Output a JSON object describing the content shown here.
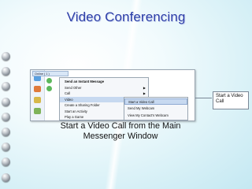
{
  "slide": {
    "title": "Video Conferencing",
    "caption": "Start a Video Call from the Main Messenger Window",
    "callout": "Start a Video Call",
    "colors": {
      "title": "#2c3fa8",
      "background": "#d9f1f7"
    }
  },
  "screenshot": {
    "contact_title": "Online ( 1 )",
    "menu_items": [
      {
        "label": "Send an Instant Message",
        "bold": true,
        "arrow": ""
      },
      {
        "label": "Send Other",
        "bold": false,
        "arrow": "▶"
      },
      {
        "label": "Call",
        "bold": false,
        "arrow": "▶"
      },
      {
        "label": "Video",
        "bold": false,
        "arrow": "▶"
      },
      {
        "label": "Create a Sharing Folder",
        "bold": false,
        "arrow": ""
      },
      {
        "label": "Start an Activity",
        "bold": false,
        "arrow": "▶"
      },
      {
        "label": "Play a Game",
        "bold": false,
        "arrow": "▶"
      }
    ],
    "submenu_items": [
      {
        "label": "Start a Video Call"
      },
      {
        "label": "Send My Webcam"
      },
      {
        "label": "View My Contact's Webcam"
      }
    ]
  }
}
